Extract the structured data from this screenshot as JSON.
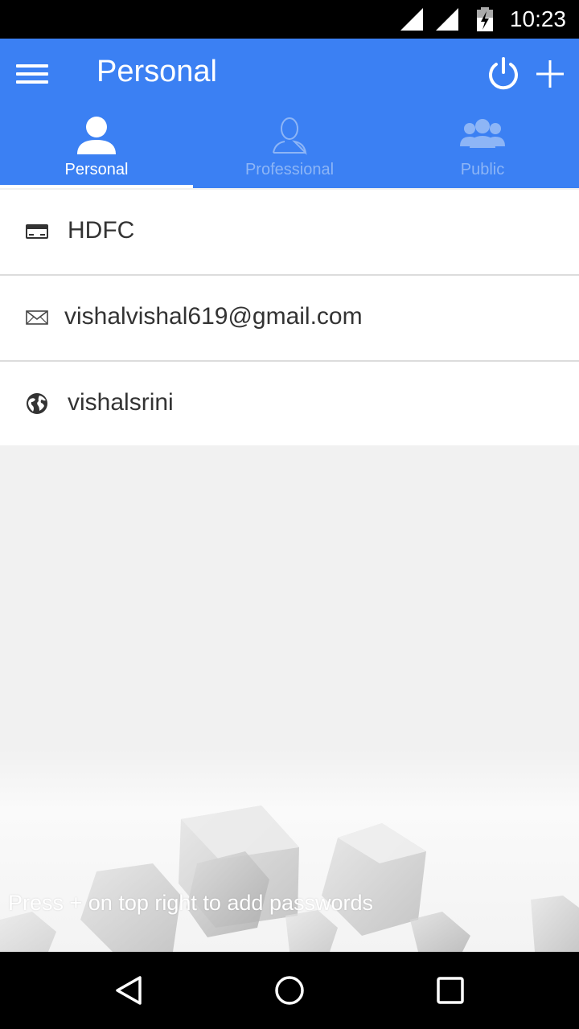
{
  "status_bar": {
    "time": "10:23"
  },
  "app_bar": {
    "title": "Personal"
  },
  "tabs": [
    {
      "label": "Personal",
      "icon": "person-icon",
      "active": true
    },
    {
      "label": "Professional",
      "icon": "person-outline-icon",
      "active": false
    },
    {
      "label": "Public",
      "icon": "group-icon",
      "active": false
    }
  ],
  "entries": [
    {
      "label": "HDFC",
      "icon": "credit-card-icon"
    },
    {
      "label": "vishalvishal619@gmail.com",
      "icon": "mail-icon"
    },
    {
      "label": "vishalsrini",
      "icon": "globe-icon"
    }
  ],
  "hint": "Press + on top right to add passwords",
  "colors": {
    "primary": "#3b80f3",
    "tab_inactive": "#8db5f6"
  }
}
